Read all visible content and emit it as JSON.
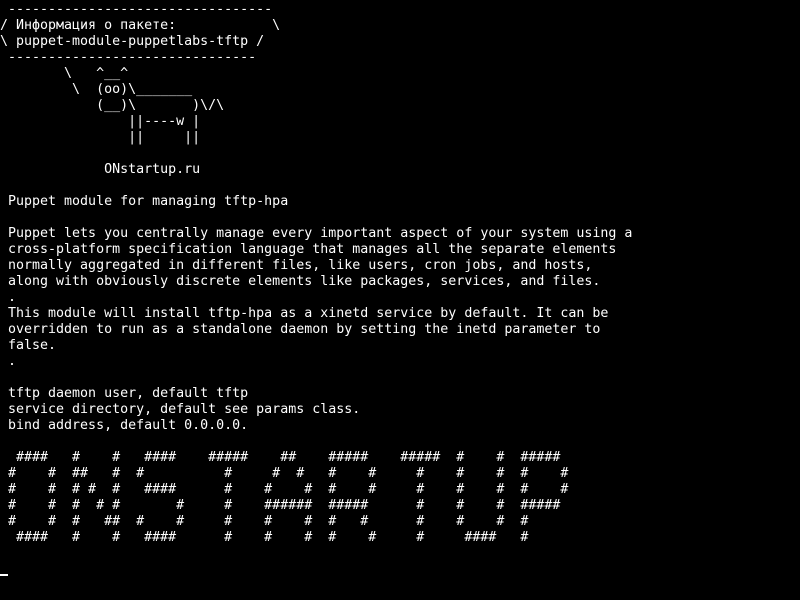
{
  "terminal": {
    "lines": [
      " ---------------------------------",
      "/ Информация о пакете:            \\",
      "\\ puppet-module-puppetlabs-tftp /",
      " -------------------------------",
      "        \\   ^__^",
      "         \\  (oo)\\_______",
      "            (__)\\       )\\/\\",
      "                ||----w |",
      "                ||     ||",
      "",
      "             ONstartup.ru",
      "",
      " Puppet module for managing tftp-hpa",
      "",
      " Puppet lets you centrally manage every important aspect of your system using a",
      " cross-platform specification language that manages all the separate elements",
      " normally aggregated in different files, like users, cron jobs, and hosts,",
      " along with obviously discrete elements like packages, services, and files.",
      " .",
      " This module will install tftp-hpa as a xinetd service by default. It can be",
      " overridden to run as a standalone daemon by setting the inetd parameter to",
      " false.",
      " .",
      "",
      " tftp daemon user, default tftp",
      " service directory, default see params class.",
      " bind address, default 0.0.0.0.",
      "",
      "  ####   #    #   ####    #####    ##    #####    #####  #    #  #####",
      " #    #  ##   #  #          #     #  #   #    #     #    #    #  #    #",
      " #    #  # #  #   ####      #    #    #  #    #     #    #    #  #    #",
      " #    #  #  # #       #     #    ######  #####      #    #    #  #####",
      " #    #  #   ##  #    #     #    #    #  #   #      #    #    #  #",
      "  ####   #    #   ####      #    #    #  #    #     #     ####   #"
    ]
  }
}
